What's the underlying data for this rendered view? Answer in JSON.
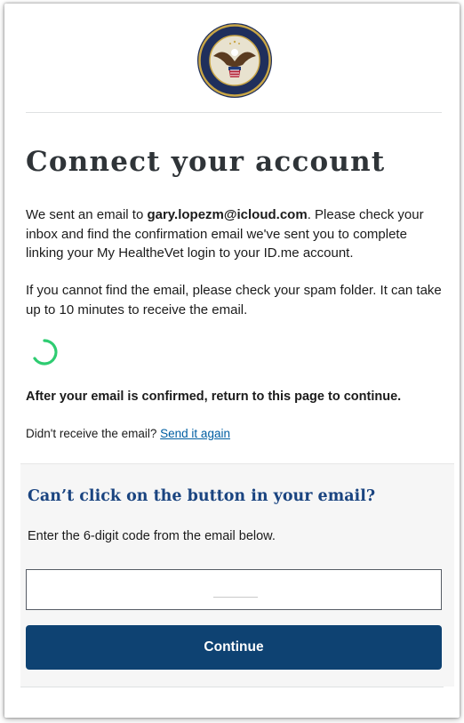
{
  "header": {
    "logo_icon": "va-department-seal-icon"
  },
  "main": {
    "title": "Connect your account",
    "message": {
      "prefix": "We sent an email to ",
      "email": "gary.lopezm@icloud.com",
      "suffix": ". Please check your inbox and find the confirmation email we've sent you to complete linking your My HealtheVet login to your ID.me account."
    },
    "spam_notice": "If you cannot find the email, please check your spam folder. It can take up to 10 minutes to receive the email.",
    "spinner_icon": "loading-spinner-icon",
    "after_confirm": "After your email is confirmed, return to this page to continue.",
    "resend": {
      "prompt": "Didn't receive the email? ",
      "link_label": "Send it again"
    }
  },
  "code_section": {
    "heading": "Can’t click on the button in your email?",
    "instructions": "Enter the 6-digit code from the email below.",
    "input_value": "",
    "continue_label": "Continue"
  },
  "colors": {
    "title": "#2f3438",
    "heading_blue": "#1a4480",
    "link_blue": "#005ea2",
    "button_bg": "#0e4272",
    "spinner_green": "#2ecc71",
    "section_bg": "#f6f6f6"
  }
}
